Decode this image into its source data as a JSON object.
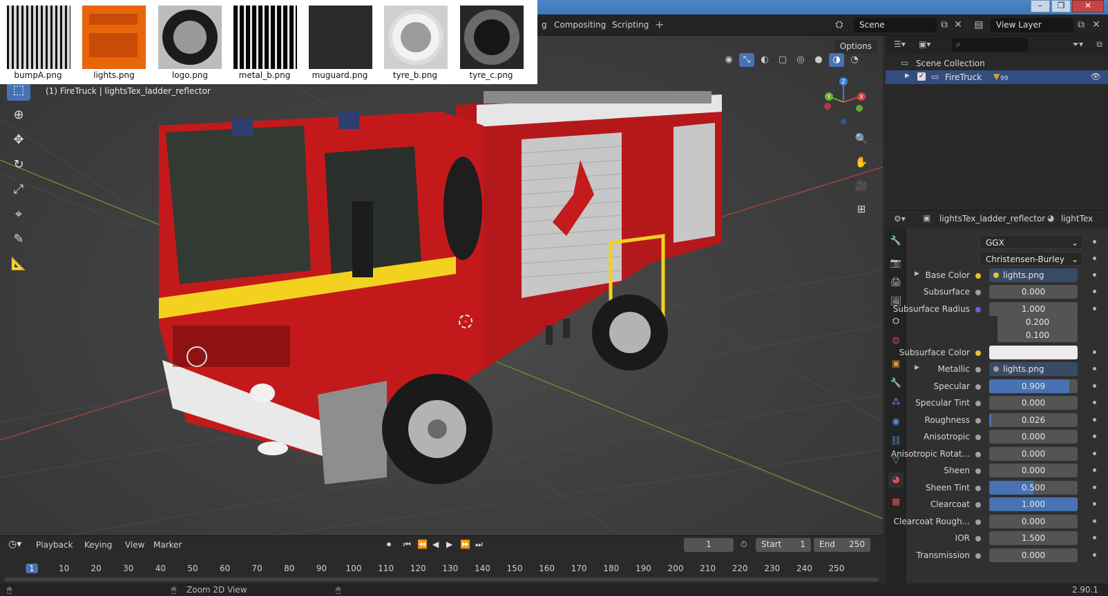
{
  "window": {
    "title": ""
  },
  "header": {
    "tabs": [
      "g",
      "Compositing",
      "Scripting"
    ],
    "add_tab": "+",
    "scene": "Scene",
    "view_layer": "View Layer"
  },
  "image_strip": [
    {
      "name": "bumpA.png",
      "color": "#8a8a8a"
    },
    {
      "name": "lights.png",
      "color": "#e8650c"
    },
    {
      "name": "logo.png",
      "color": "#bcbcbc"
    },
    {
      "name": "metal_b.png",
      "color": "#111111"
    },
    {
      "name": "muguard.png",
      "color": "#2a2a2a"
    },
    {
      "name": "tyre_b.png",
      "color": "#cfcfcf"
    },
    {
      "name": "tyre_c.png",
      "color": "#272727"
    }
  ],
  "viewport": {
    "info": "(1) FireTruck | lightsTex_ladder_reflector",
    "options_label": "Options",
    "gizmo": {
      "x": "X",
      "y": "Y",
      "z": "Z"
    }
  },
  "outliner": {
    "search_placeholder": "",
    "scene_collection": "Scene Collection",
    "item": "FireTruck",
    "item_badge": "99"
  },
  "properties": {
    "material_name": "lightsTex_ladder_reflector",
    "shader_name": "lightTex",
    "distribution": "GGX",
    "subsurface_method": "Christensen-Burley",
    "rows": [
      {
        "label": "Base Color",
        "type": "link",
        "value": "lights.png",
        "dot": "yellow",
        "expand": true
      },
      {
        "label": "Subsurface",
        "type": "num",
        "value": "0.000",
        "fill": 0
      },
      {
        "label": "Subsurface Radius",
        "type": "num",
        "value": "1.000",
        "fill": 0,
        "dot": "purple"
      },
      {
        "label": "",
        "type": "num",
        "value": "0.200",
        "fill": 0,
        "nodot": true
      },
      {
        "label": "",
        "type": "num",
        "value": "0.100",
        "fill": 0,
        "nodot": true
      },
      {
        "label": "Subsurface Color",
        "type": "color",
        "value": "",
        "dot": "yellow"
      },
      {
        "label": "Metallic",
        "type": "link",
        "value": "lights.png",
        "expand": true
      },
      {
        "label": "Specular",
        "type": "num",
        "value": "0.909",
        "fill": 0.909
      },
      {
        "label": "Specular Tint",
        "type": "num",
        "value": "0.000",
        "fill": 0
      },
      {
        "label": "Roughness",
        "type": "num",
        "value": "0.026",
        "fill": 0.026
      },
      {
        "label": "Anisotropic",
        "type": "num",
        "value": "0.000",
        "fill": 0
      },
      {
        "label": "Anisotropic Rotat...",
        "type": "num",
        "value": "0.000",
        "fill": 0
      },
      {
        "label": "Sheen",
        "type": "num",
        "value": "0.000",
        "fill": 0
      },
      {
        "label": "Sheen Tint",
        "type": "num",
        "value": "0.500",
        "fill": 0.5
      },
      {
        "label": "Clearcoat",
        "type": "num",
        "value": "1.000",
        "fill": 1
      },
      {
        "label": "Clearcoat Rough...",
        "type": "num",
        "value": "0.000",
        "fill": 0
      },
      {
        "label": "IOR",
        "type": "num",
        "value": "1.500",
        "fill": 0
      },
      {
        "label": "Transmission",
        "type": "num",
        "value": "0.000",
        "fill": 0
      }
    ]
  },
  "timeline": {
    "menus": [
      "Playback",
      "Keying",
      "View",
      "Marker"
    ],
    "current_frame": "1",
    "start_label": "Start",
    "start": "1",
    "end_label": "End",
    "end": "250",
    "ticks": [
      "1",
      "10",
      "20",
      "30",
      "40",
      "50",
      "60",
      "70",
      "80",
      "90",
      "100",
      "110",
      "120",
      "130",
      "140",
      "150",
      "160",
      "170",
      "180",
      "190",
      "200",
      "210",
      "220",
      "230",
      "240",
      "250"
    ]
  },
  "statusbar": {
    "text": "Zoom 2D View",
    "version": "2.90.1"
  },
  "colors": {
    "accent": "#4772b3",
    "truck_red": "#c4191b",
    "stripe_yellow": "#f2d21e"
  }
}
